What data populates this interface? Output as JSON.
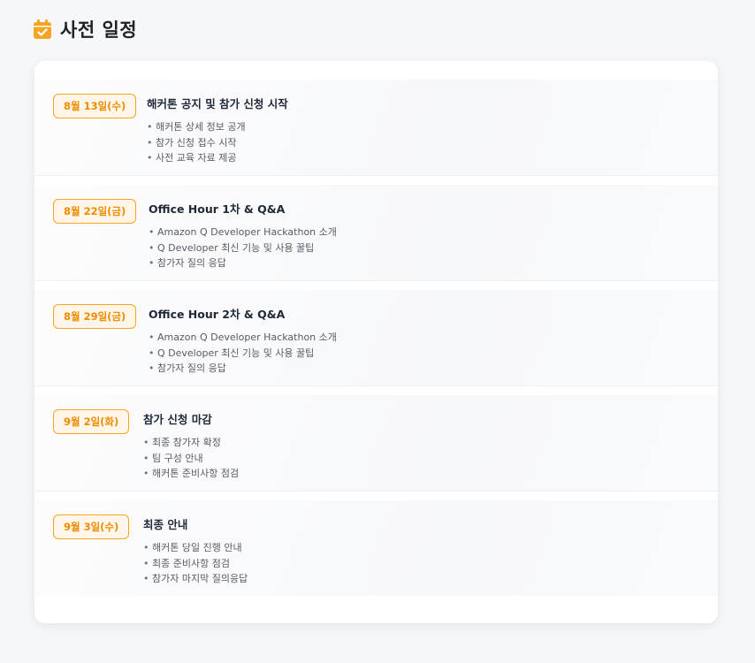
{
  "header": {
    "title": "사전 일정",
    "icon": "calendar-check-icon",
    "icon_color": "#f5a524"
  },
  "colors": {
    "accent": "#f08c00",
    "badge_border": "#f5a524"
  },
  "events": [
    {
      "date": "8월 13일(수)",
      "title": "해커톤 공지 및 참가 신청 시작",
      "items": [
        "해커톤 상세 정보 공개",
        "참가 신청 접수 시작",
        "사전 교육 자료 제공"
      ]
    },
    {
      "date": "8월 22일(금)",
      "title": "Office Hour 1차 & Q&A",
      "items": [
        "Amazon Q Developer Hackathon 소개",
        "Q Developer 최신 기능 및 사용 꿀팁",
        "참가자 질의 응답"
      ]
    },
    {
      "date": "8월 29일(금)",
      "title": "Office Hour 2차 & Q&A",
      "items": [
        "Amazon Q Developer Hackathon 소개",
        "Q Developer 최신 기능 및 사용 꿀팁",
        "참가자 질의 응답"
      ]
    },
    {
      "date": "9월 2일(화)",
      "title": "참가 신청 마감",
      "items": [
        "최종 참가자 확정",
        "팀 구성 안내",
        "해커톤 준비사항 점검"
      ]
    },
    {
      "date": "9월 3일(수)",
      "title": "최종 안내",
      "items": [
        "해커톤 당일 진행 안내",
        "최종 준비사항 점검",
        "참가자 마지막 질의응답"
      ]
    }
  ]
}
